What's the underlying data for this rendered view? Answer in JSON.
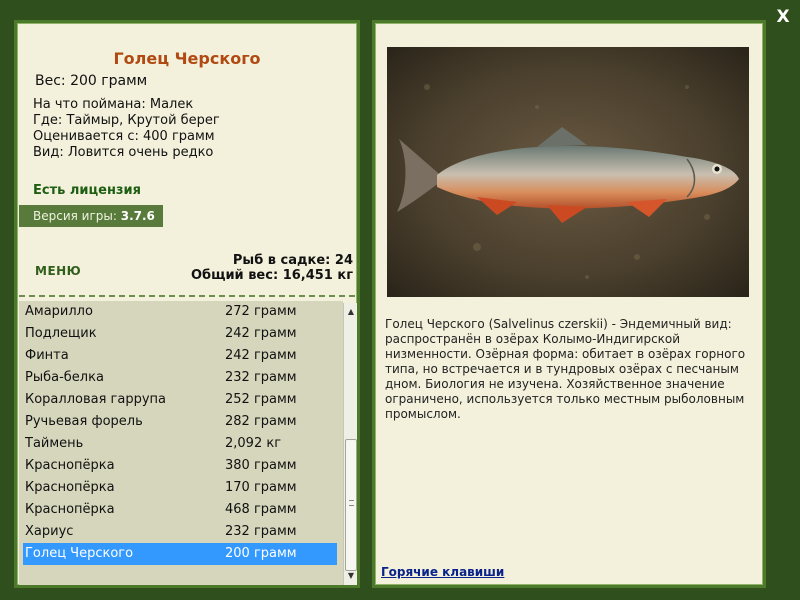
{
  "window": {
    "close_label": "X"
  },
  "fish": {
    "title": "Голец Черского",
    "weight_label": "Вес:",
    "weight_value": "200 грамм",
    "details": [
      {
        "label": "На что поймана:",
        "value": "Малек"
      },
      {
        "label": "Где:",
        "value": "Таймыр, Крутой берег"
      },
      {
        "label": "Оценивается с:",
        "value": "400 грамм"
      },
      {
        "label": "Вид:",
        "value": "Ловится очень редко"
      }
    ]
  },
  "license": {
    "text": "Есть лицензия"
  },
  "version": {
    "label": "Версия игры:",
    "value": "3.7.6"
  },
  "menu": {
    "label": "МЕНЮ"
  },
  "stats": {
    "cage_label": "Рыб в садке:",
    "cage_value": "24",
    "total_label": "Общий вес:",
    "total_value": "16,451 кг"
  },
  "catch_list": [
    {
      "name": "Амарилло",
      "weight": "272 грамм"
    },
    {
      "name": "Подлещик",
      "weight": "242 грамм"
    },
    {
      "name": "Финта",
      "weight": "242 грамм"
    },
    {
      "name": "Рыба-белка",
      "weight": "232 грамм"
    },
    {
      "name": "Коралловая гаррупа",
      "weight": "252 грамм"
    },
    {
      "name": "Ручьевая форель",
      "weight": "282 грамм"
    },
    {
      "name": "Таймень",
      "weight": "2,092 кг"
    },
    {
      "name": "Краснопёрка",
      "weight": "380 грамм"
    },
    {
      "name": "Краснопёрка",
      "weight": "170 грамм"
    },
    {
      "name": "Краснопёрка",
      "weight": "468 грамм"
    },
    {
      "name": "Хариус",
      "weight": "232 грамм"
    },
    {
      "name": "Голец Черского",
      "weight": "200 грамм",
      "selected": true
    }
  ],
  "description": "Голец Черского (Salvelinus czerskii) - Эндемичный вид: распространён в озёрах Колымо-Индигирской низменности. Озёрная форма: обитает в озёрах горного типа, но встречается и в тундровых озёрах с песчаным дном. Биология не изучена. Хозяйственное значение ограничено, используется только местным рыболовным промыслом.",
  "hotkeys": {
    "label": "Горячие клавиши"
  },
  "colors": {
    "background": "#2f4f1c",
    "panel": "#f3f1dc",
    "panel_border": "#4d7a2a",
    "title": "#b04a12",
    "license": "#1d5e12",
    "selection": "#3399ff",
    "link": "#0a238a"
  },
  "icons": {
    "close": "close-icon",
    "photo": "fish-photo"
  }
}
